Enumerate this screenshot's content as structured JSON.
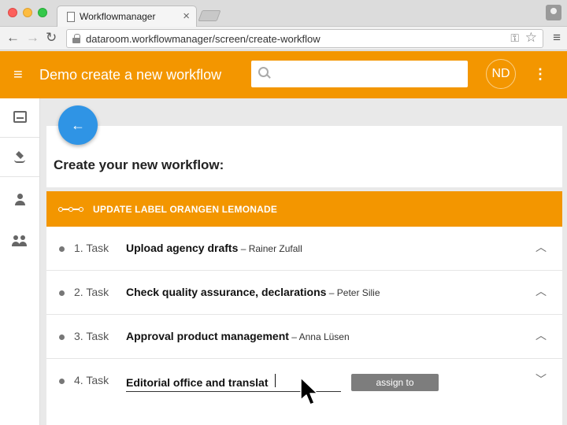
{
  "browser": {
    "tab_title": "Workflowmanager",
    "tab_close": "×",
    "url": "dataroom.workflowmanager/screen/create-workflow",
    "nav": {
      "back": "←",
      "forward": "→",
      "reload": "↻",
      "menu": "≡",
      "bookmark": "☆",
      "key": "⚿"
    }
  },
  "appbar": {
    "menu_glyph": "≡",
    "title": "Demo create a new workflow",
    "search_placeholder": "",
    "avatar_initials": "ND",
    "more_glyph": "⋮"
  },
  "sidebar": {
    "items": [
      {
        "icon": "inbox-icon"
      },
      {
        "icon": "layers-icon"
      },
      {
        "icon": "person-icon"
      },
      {
        "icon": "group-icon"
      }
    ]
  },
  "page": {
    "back_glyph": "←",
    "heading": "Create your new workflow:"
  },
  "workflow": {
    "title": "UPDATE LABEL ORANGEN LEMONADE",
    "tasks": [
      {
        "number": "1. Task",
        "name": "Upload agency drafts",
        "assignee": " – Rainer Zufall",
        "chevron": "︿"
      },
      {
        "number": "2. Task",
        "name": "Check quality assurance, declarations",
        "assignee": " – Peter Silie",
        "chevron": "︿"
      },
      {
        "number": "3. Task",
        "name": "Approval product management",
        "assignee": " – Anna Lüsen",
        "chevron": "︿"
      }
    ],
    "editing_task": {
      "number": "4. Task",
      "input_value": "Editorial office and translat",
      "assign_label": "assign to",
      "chevron": "﹀"
    }
  },
  "colors": {
    "accent": "#f39600",
    "fab": "#2f94e5",
    "assign_button": "#7d7d7d"
  }
}
